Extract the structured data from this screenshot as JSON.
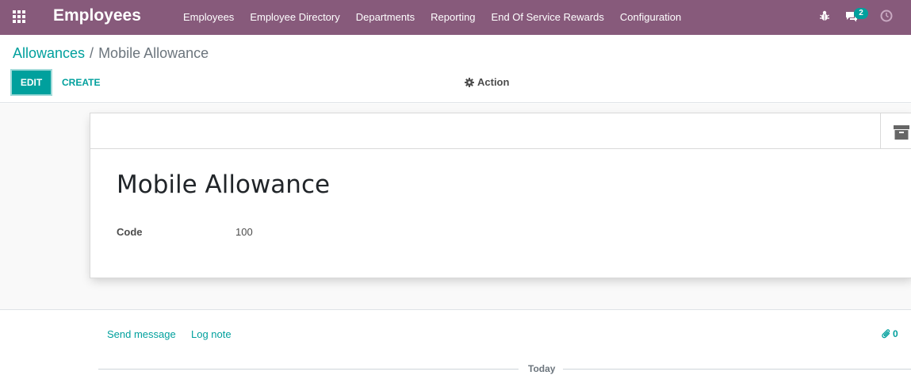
{
  "navbar": {
    "brand": "Employees",
    "menu": [
      "Employees",
      "Employee Directory",
      "Departments",
      "Reporting",
      "End Of Service Rewards",
      "Configuration"
    ],
    "chat_badge": "2",
    "icons": [
      "apps-grid-icon",
      "bug-icon",
      "chat-icon",
      "clock-icon"
    ],
    "color": "#875a7b"
  },
  "breadcrumb": {
    "parent": "Allowances",
    "separator": "/",
    "current": "Mobile Allowance"
  },
  "toolbar": {
    "edit_label": "EDIT",
    "create_label": "CREATE",
    "action_label": "Action"
  },
  "form": {
    "title": "Mobile Allowance",
    "code_label": "Code",
    "code_value": "100"
  },
  "chatter": {
    "send_message": "Send message",
    "log_note": "Log note",
    "attachments_count": "0",
    "date_separator": "Today"
  },
  "colors": {
    "accent": "#00a09d",
    "navbar": "#875a7b"
  }
}
